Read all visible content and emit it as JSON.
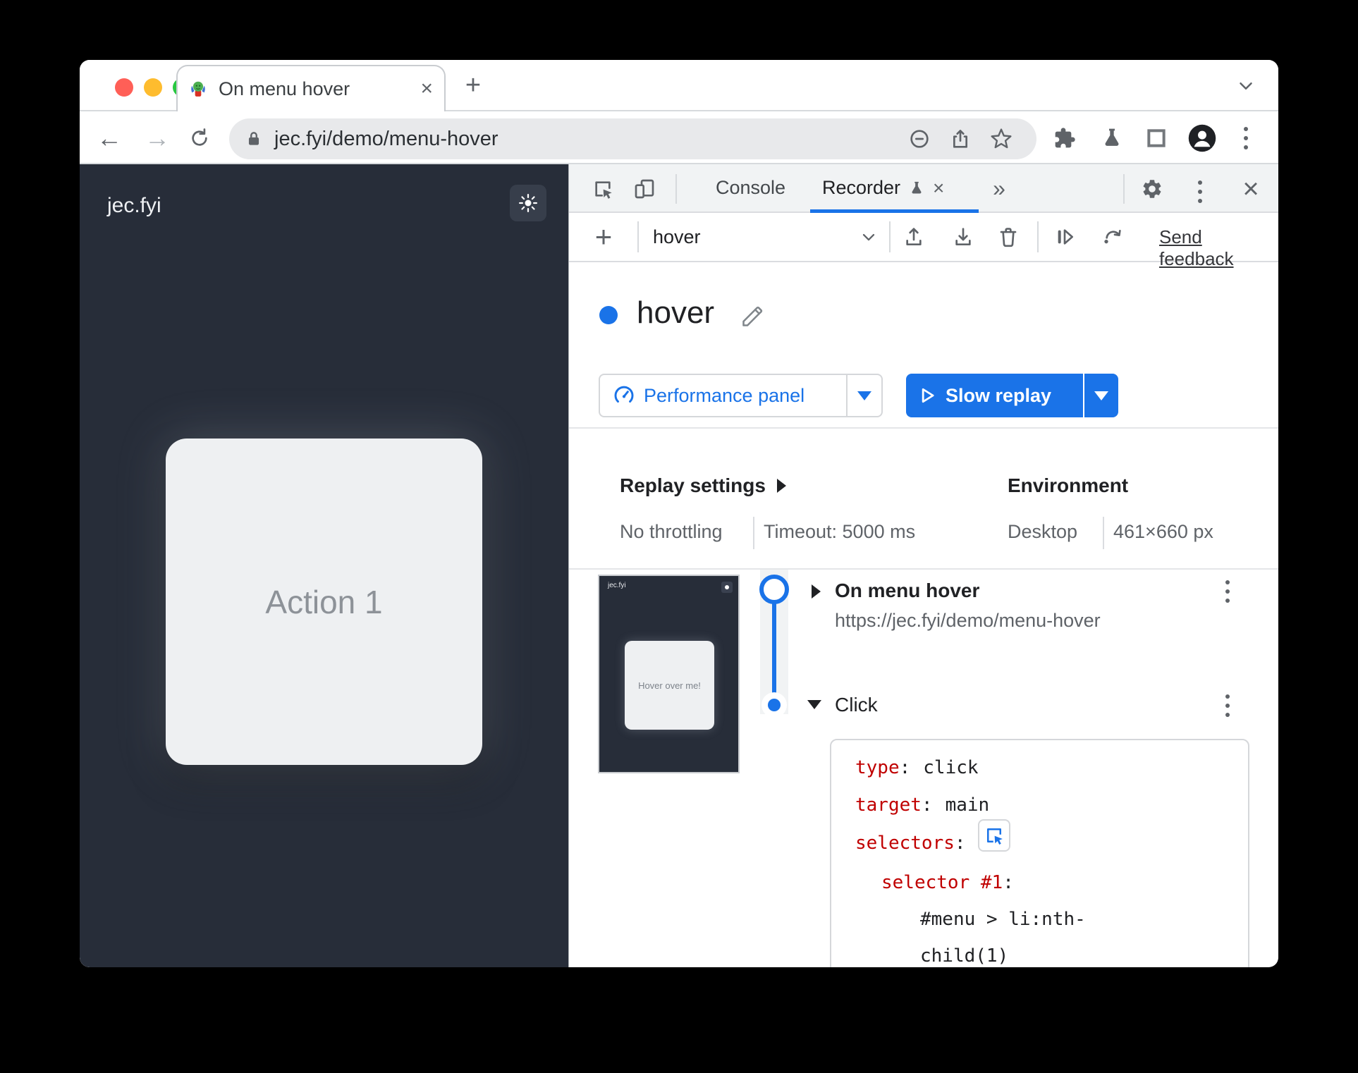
{
  "window": {
    "tab_title": "On menu hover",
    "url": "jec.fyi/demo/menu-hover"
  },
  "glyphs": {
    "back": "←",
    "forward": "→",
    "new_tab": "+",
    "close": "×",
    "more_tabs": "»",
    "add": "+"
  },
  "page": {
    "site": "jec.fyi",
    "card_label": "Action 1"
  },
  "devtools": {
    "tabs": {
      "console": "Console",
      "recorder": "Recorder"
    },
    "toolbar": {
      "recording": "hover",
      "send_feedback": "Send feedback"
    },
    "recording": {
      "title": "hover"
    },
    "actions": {
      "performance": "Performance panel",
      "slow_replay": "Slow replay"
    },
    "replay_settings": {
      "heading": "Replay settings",
      "throttling": "No throttling",
      "timeout": "Timeout: 5000 ms"
    },
    "environment": {
      "heading": "Environment",
      "device": "Desktop",
      "viewport": "461×660 px"
    },
    "steps": {
      "thumb": {
        "site": "jec.fyi",
        "card_label": "Hover over me!"
      },
      "step1": {
        "title": "On menu hover",
        "url": "https://jec.fyi/demo/menu-hover"
      },
      "step2": {
        "title": "Click"
      },
      "code": {
        "l1": {
          "key": "type",
          "sep": ":",
          "value": "click"
        },
        "l2": {
          "key": "target",
          "sep": ":",
          "value": "main"
        },
        "l3": {
          "key": "selectors",
          "sep": ":"
        },
        "l4": {
          "key": "selector #1",
          "sep": ":"
        },
        "l5": {
          "value": "#menu > li:nth-"
        },
        "l6": {
          "value": "child(1)"
        }
      }
    }
  },
  "colors": {
    "accent": "#1a73e8",
    "code_key": "#c00000",
    "page_background": "#272d39",
    "devtools_tabbar": "#f1f3f4",
    "traffic_red": "#ff5f57",
    "traffic_yellow": "#febc2e",
    "traffic_green": "#28c840"
  }
}
